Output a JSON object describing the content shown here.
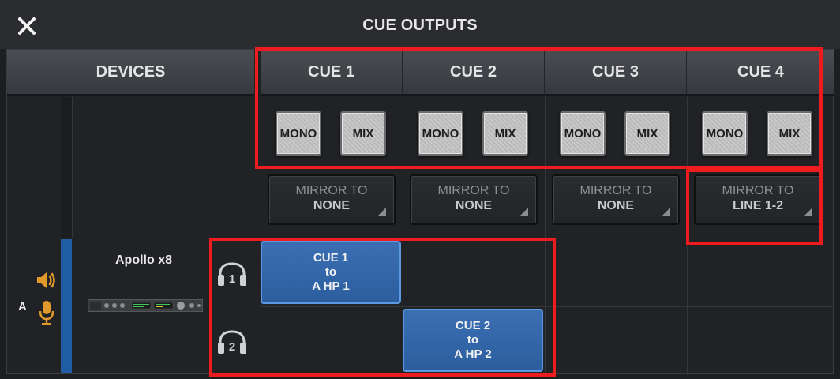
{
  "window": {
    "title": "CUE OUTPUTS",
    "close_icon": "close-icon"
  },
  "header": {
    "devices_label": "DEVICES",
    "cues": [
      {
        "label": "CUE 1",
        "mono_label": "MONO",
        "mix_label": "MIX",
        "mirror_line1": "MIRROR TO",
        "mirror_line2": "NONE"
      },
      {
        "label": "CUE 2",
        "mono_label": "MONO",
        "mix_label": "MIX",
        "mirror_line1": "MIRROR TO",
        "mirror_line2": "NONE"
      },
      {
        "label": "CUE 3",
        "mono_label": "MONO",
        "mix_label": "MIX",
        "mirror_line1": "MIRROR TO",
        "mirror_line2": "NONE"
      },
      {
        "label": "CUE 4",
        "mono_label": "MONO",
        "mix_label": "MIX",
        "mirror_line1": "MIRROR TO",
        "mirror_line2": "LINE 1-2"
      }
    ]
  },
  "device": {
    "letter": "A",
    "name": "Apollo x8",
    "outputs": [
      {
        "icon": "headphone-1-icon",
        "number": "1"
      },
      {
        "icon": "headphone-2-icon",
        "number": "2"
      }
    ],
    "assignments": [
      {
        "line1": "CUE 1",
        "line2": "to",
        "line3": "A HP 1"
      },
      {
        "line1": "CUE 2",
        "line2": "to",
        "line3": "A HP 2"
      }
    ]
  },
  "colors": {
    "accent_blue": "#2c5e9f",
    "icon_orange": "#e09a2b",
    "highlight_red": "#ee1c1c"
  }
}
